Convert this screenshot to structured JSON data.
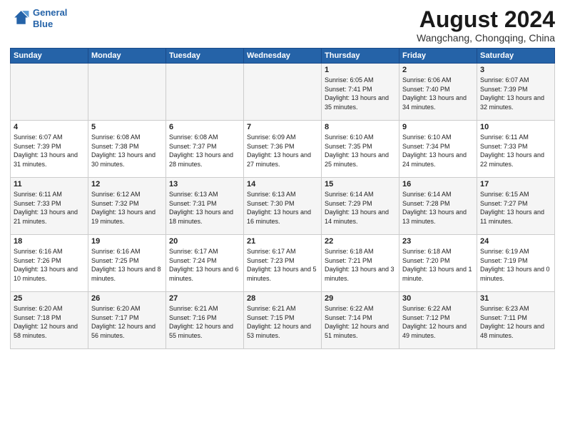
{
  "header": {
    "logo_line1": "General",
    "logo_line2": "Blue",
    "main_title": "August 2024",
    "subtitle": "Wangchang, Chongqing, China"
  },
  "weekdays": [
    "Sunday",
    "Monday",
    "Tuesday",
    "Wednesday",
    "Thursday",
    "Friday",
    "Saturday"
  ],
  "rows": [
    [
      {
        "num": "",
        "sunrise": "",
        "sunset": "",
        "daylight": ""
      },
      {
        "num": "",
        "sunrise": "",
        "sunset": "",
        "daylight": ""
      },
      {
        "num": "",
        "sunrise": "",
        "sunset": "",
        "daylight": ""
      },
      {
        "num": "",
        "sunrise": "",
        "sunset": "",
        "daylight": ""
      },
      {
        "num": "1",
        "sunrise": "6:05 AM",
        "sunset": "7:41 PM",
        "daylight": "13 hours and 35 minutes."
      },
      {
        "num": "2",
        "sunrise": "6:06 AM",
        "sunset": "7:40 PM",
        "daylight": "13 hours and 34 minutes."
      },
      {
        "num": "3",
        "sunrise": "6:07 AM",
        "sunset": "7:39 PM",
        "daylight": "13 hours and 32 minutes."
      }
    ],
    [
      {
        "num": "4",
        "sunrise": "6:07 AM",
        "sunset": "7:39 PM",
        "daylight": "13 hours and 31 minutes."
      },
      {
        "num": "5",
        "sunrise": "6:08 AM",
        "sunset": "7:38 PM",
        "daylight": "13 hours and 30 minutes."
      },
      {
        "num": "6",
        "sunrise": "6:08 AM",
        "sunset": "7:37 PM",
        "daylight": "13 hours and 28 minutes."
      },
      {
        "num": "7",
        "sunrise": "6:09 AM",
        "sunset": "7:36 PM",
        "daylight": "13 hours and 27 minutes."
      },
      {
        "num": "8",
        "sunrise": "6:10 AM",
        "sunset": "7:35 PM",
        "daylight": "13 hours and 25 minutes."
      },
      {
        "num": "9",
        "sunrise": "6:10 AM",
        "sunset": "7:34 PM",
        "daylight": "13 hours and 24 minutes."
      },
      {
        "num": "10",
        "sunrise": "6:11 AM",
        "sunset": "7:33 PM",
        "daylight": "13 hours and 22 minutes."
      }
    ],
    [
      {
        "num": "11",
        "sunrise": "6:11 AM",
        "sunset": "7:33 PM",
        "daylight": "13 hours and 21 minutes."
      },
      {
        "num": "12",
        "sunrise": "6:12 AM",
        "sunset": "7:32 PM",
        "daylight": "13 hours and 19 minutes."
      },
      {
        "num": "13",
        "sunrise": "6:13 AM",
        "sunset": "7:31 PM",
        "daylight": "13 hours and 18 minutes."
      },
      {
        "num": "14",
        "sunrise": "6:13 AM",
        "sunset": "7:30 PM",
        "daylight": "13 hours and 16 minutes."
      },
      {
        "num": "15",
        "sunrise": "6:14 AM",
        "sunset": "7:29 PM",
        "daylight": "13 hours and 14 minutes."
      },
      {
        "num": "16",
        "sunrise": "6:14 AM",
        "sunset": "7:28 PM",
        "daylight": "13 hours and 13 minutes."
      },
      {
        "num": "17",
        "sunrise": "6:15 AM",
        "sunset": "7:27 PM",
        "daylight": "13 hours and 11 minutes."
      }
    ],
    [
      {
        "num": "18",
        "sunrise": "6:16 AM",
        "sunset": "7:26 PM",
        "daylight": "13 hours and 10 minutes."
      },
      {
        "num": "19",
        "sunrise": "6:16 AM",
        "sunset": "7:25 PM",
        "daylight": "13 hours and 8 minutes."
      },
      {
        "num": "20",
        "sunrise": "6:17 AM",
        "sunset": "7:24 PM",
        "daylight": "13 hours and 6 minutes."
      },
      {
        "num": "21",
        "sunrise": "6:17 AM",
        "sunset": "7:23 PM",
        "daylight": "13 hours and 5 minutes."
      },
      {
        "num": "22",
        "sunrise": "6:18 AM",
        "sunset": "7:21 PM",
        "daylight": "13 hours and 3 minutes."
      },
      {
        "num": "23",
        "sunrise": "6:18 AM",
        "sunset": "7:20 PM",
        "daylight": "13 hours and 1 minute."
      },
      {
        "num": "24",
        "sunrise": "6:19 AM",
        "sunset": "7:19 PM",
        "daylight": "13 hours and 0 minutes."
      }
    ],
    [
      {
        "num": "25",
        "sunrise": "6:20 AM",
        "sunset": "7:18 PM",
        "daylight": "12 hours and 58 minutes."
      },
      {
        "num": "26",
        "sunrise": "6:20 AM",
        "sunset": "7:17 PM",
        "daylight": "12 hours and 56 minutes."
      },
      {
        "num": "27",
        "sunrise": "6:21 AM",
        "sunset": "7:16 PM",
        "daylight": "12 hours and 55 minutes."
      },
      {
        "num": "28",
        "sunrise": "6:21 AM",
        "sunset": "7:15 PM",
        "daylight": "12 hours and 53 minutes."
      },
      {
        "num": "29",
        "sunrise": "6:22 AM",
        "sunset": "7:14 PM",
        "daylight": "12 hours and 51 minutes."
      },
      {
        "num": "30",
        "sunrise": "6:22 AM",
        "sunset": "7:12 PM",
        "daylight": "12 hours and 49 minutes."
      },
      {
        "num": "31",
        "sunrise": "6:23 AM",
        "sunset": "7:11 PM",
        "daylight": "12 hours and 48 minutes."
      }
    ]
  ],
  "labels": {
    "sunrise": "Sunrise:",
    "sunset": "Sunset:",
    "daylight": "Daylight:"
  }
}
